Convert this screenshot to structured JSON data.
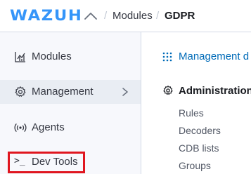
{
  "header": {
    "logo_text": "WAZUH",
    "menu_icon": "chevron-up-icon",
    "breadcrumb": {
      "separator": "/",
      "items": [
        {
          "label": "Modules"
        },
        {
          "label": "GDPR"
        }
      ]
    }
  },
  "sidebar": {
    "items": [
      {
        "label": "Modules",
        "icon": "chart-bars-icon"
      },
      {
        "label": "Management",
        "icon": "gear-icon",
        "has_submenu": true,
        "expand_icon": "chevron-right-icon"
      },
      {
        "label": "Agents",
        "icon": "radio-waves-icon"
      },
      {
        "label": "Dev Tools",
        "icon": "terminal-icon",
        "icon_glyph": ">_"
      }
    ],
    "highlight_color": "#e0161f"
  },
  "management_panel": {
    "title": "Management d",
    "title_icon": "grid-dots-icon",
    "section": {
      "title": "Administration",
      "icon": "gear-icon",
      "items": [
        {
          "label": "Rules"
        },
        {
          "label": "Decoders"
        },
        {
          "label": "CDB lists"
        },
        {
          "label": "Groups"
        }
      ]
    }
  },
  "colors": {
    "brand": "#3595f9",
    "link": "#006bb8",
    "text": "#343741",
    "sidebar_bg": "#f7f8fc",
    "active_bg": "#e9edf3",
    "border": "#d3dae6"
  }
}
